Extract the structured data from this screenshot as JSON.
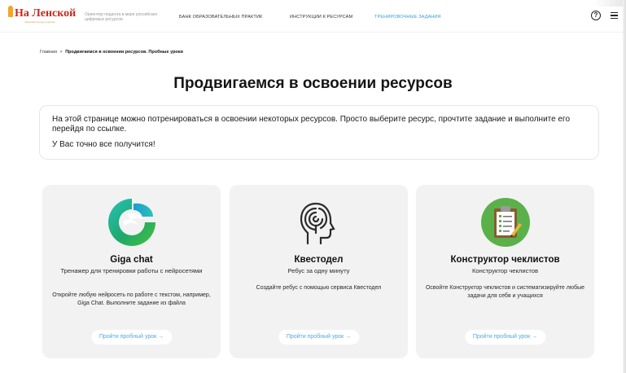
{
  "header": {
    "logo": "На Ленской",
    "logo_subtitle": "образовательные практики",
    "tagline": "Ориентир педагога в мире российских цифровых ресурсов",
    "nav": [
      {
        "label": "БАНК ОБРАЗОВАТЕЛЬНЫХ ПРАКТИК",
        "active": false
      },
      {
        "label": "ИНСТРУКЦИИ К РЕСУРСАМ",
        "active": false
      },
      {
        "label": "ТРЕНИРОВОЧНЫЕ ЗАДАНИЯ",
        "active": true
      }
    ],
    "help_glyph": "?",
    "icons": [
      "help-icon",
      "menu-icon"
    ]
  },
  "breadcrumb": {
    "home": "Главная",
    "separator": ">",
    "current": "Продвигаемся в освоении ресурсов. Пробные уроки"
  },
  "page_title": "Продвигаемся в освоении ресурсов",
  "intro": {
    "text1": "На этой странице можно потренироваться в освоении некоторых ресурсов. Просто выберите ресурс, прочтите задание и выполните его перейдя по ссылке.",
    "text2": "У Вас точно все получится!"
  },
  "cards": [
    {
      "icon": "gigachat-logo-icon",
      "title": "Giga chat",
      "subtitle": "Тренажер для тренировки работы с нейросетями",
      "description": "Откройте любую нейросеть по работе с текстом, например, Giga Chat. Выполните задание из файла",
      "button": "Пройти пробный урок →"
    },
    {
      "icon": "maze-head-icon",
      "title": "Квестодел",
      "subtitle": "Ребус за одну минуту",
      "description": "Создайте ребус с помощью сервиса Квестодел",
      "button": "Пройти пробный урок →"
    },
    {
      "icon": "checklist-clipboard-icon",
      "title": "Конструктор чеклистов",
      "subtitle": "Конструктор чеклистов",
      "description": "Освойте Конструктор чеклистов и систематизируйте любые задачи для себя и учащихся",
      "button": "Пройти пробный урок →"
    }
  ],
  "colors": {
    "accent": "#3a9ad9",
    "logo": "#c6281e",
    "card_bg": "#f2f2f2",
    "button_text": "#5aa6dc"
  }
}
